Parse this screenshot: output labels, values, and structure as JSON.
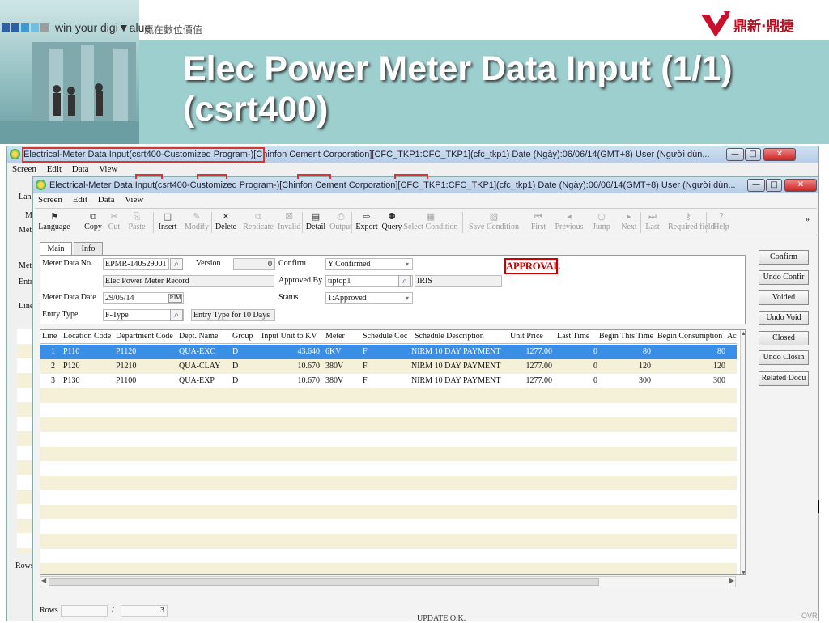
{
  "slide": {
    "brand": "win your digi▼alue",
    "brand_cn": "贏在數位價值",
    "logo_text": "鼎新·鼎捷",
    "title_line1": "Elec Power Meter Data Input (1/1)",
    "title_line2": "(csrt400)",
    "brand_colors": [
      "#2c5fa8",
      "#3a9ad6",
      "#6cc0e6",
      "#9d9d9d"
    ]
  },
  "back_window": {
    "title": "Electrical-Meter Data Input(csrt400-Customized Program-)[Chinfon Cement Corporation][CFC_TKP1:CFC_TKP1](cfc_tkp1)  Date (Ngày):06/06/14(GMT+8)  User (Người dùn...",
    "menu": [
      "Screen",
      "Edit",
      "Data",
      "View"
    ],
    "left_labels": [
      "Lan",
      "M",
      "Met",
      "Met",
      "Entr",
      "Line",
      "Rows"
    ]
  },
  "window": {
    "title": "Electrical-Meter Data Input(csrt400-Customized Program-)[Chinfon Cement Corporation][CFC_TKP1:CFC_TKP1](cfc_tkp1)  Date (Ngày):06/06/14(GMT+8)  User (Người dùn...",
    "menu": [
      "Screen",
      "Edit",
      "Data",
      "View"
    ],
    "controls": {
      "minimize": "—",
      "maximize": "□",
      "close": "✕"
    }
  },
  "toolbar": [
    {
      "label": "Language",
      "icon": "flag-icon",
      "glyph": "⚑",
      "enabled": true
    },
    {
      "label": "Copy",
      "icon": "copy-icon",
      "glyph": "⧉",
      "enabled": true
    },
    {
      "label": "Cut",
      "icon": "scissors-icon",
      "glyph": "✂",
      "enabled": false
    },
    {
      "label": "Paste",
      "icon": "paste-icon",
      "glyph": "⎘",
      "enabled": false
    },
    {
      "label": "Insert",
      "icon": "new-document-icon",
      "glyph": "□",
      "enabled": true
    },
    {
      "label": "Modify",
      "icon": "pencil-icon",
      "glyph": "✎",
      "enabled": false
    },
    {
      "label": "Delete",
      "icon": "delete-x-icon",
      "glyph": "✕",
      "enabled": true
    },
    {
      "label": "Replicate",
      "icon": "replicate-icon",
      "glyph": "⧉",
      "enabled": false
    },
    {
      "label": "Invalid",
      "icon": "trash-icon",
      "glyph": "☒",
      "enabled": false
    },
    {
      "label": "Detail",
      "icon": "detail-icon",
      "glyph": "▤",
      "enabled": true
    },
    {
      "label": "Output",
      "icon": "printer-icon",
      "glyph": "⎙",
      "enabled": false
    },
    {
      "label": "Export",
      "icon": "export-icon",
      "glyph": "⇨",
      "enabled": true
    },
    {
      "label": "Query",
      "icon": "binoculars-icon",
      "glyph": "⚉",
      "enabled": true
    },
    {
      "label": "Select Condition",
      "icon": "select-condition-icon",
      "glyph": "▦",
      "enabled": false
    },
    {
      "label": "Save Condition",
      "icon": "save-condition-icon",
      "glyph": "▧",
      "enabled": false
    },
    {
      "label": "First",
      "icon": "first-record-icon",
      "glyph": "⏮",
      "enabled": false
    },
    {
      "label": "Previous",
      "icon": "previous-record-icon",
      "glyph": "◂",
      "enabled": false
    },
    {
      "label": "Jump",
      "icon": "jump-icon",
      "glyph": "○",
      "enabled": false
    },
    {
      "label": "Next",
      "icon": "next-record-icon",
      "glyph": "▸",
      "enabled": false
    },
    {
      "label": "Last",
      "icon": "last-record-icon",
      "glyph": "⏭",
      "enabled": false
    },
    {
      "label": "Required field",
      "icon": "key-icon",
      "glyph": "⚷",
      "enabled": false
    },
    {
      "label": "Help",
      "icon": "help-icon",
      "glyph": "?",
      "enabled": false
    }
  ],
  "toolbar_more": "»",
  "tabs": [
    "Main",
    "Info"
  ],
  "form": {
    "meter_data_no_label": "Meter Data No.",
    "meter_data_no": "EPMR-140529001",
    "version_label": "Version",
    "version": "0",
    "confirm_label": "Confirm",
    "confirm_value": "Y:Confirmed",
    "description": "Elec Power Meter Record",
    "approved_by_label": "Approved By",
    "approved_by": "tiptop1",
    "approved_by_name": "IRIS",
    "meter_data_date_label": "Meter Data Date",
    "meter_data_date": "29/05/14",
    "calendar_btn": "RJM",
    "status_label": "Status",
    "status_value": "1:Approved",
    "entry_type_label": "Entry Type",
    "entry_type": "F-Type",
    "entry_type_desc": "Entry Type for 10 Days",
    "approval_stamp": "APPROVAL"
  },
  "side_buttons": [
    "Confirm",
    "Undo Confir",
    "Voided",
    "Undo Void",
    "Closed",
    "Undo Closin",
    "Related Docu"
  ],
  "grid": {
    "columns": [
      "Line",
      "Location Code",
      "Department Code",
      "Dept. Name",
      "Group",
      "Input Unit to KV",
      "Meter",
      "Schedule Coc",
      "Schedule Description",
      "Unit Price",
      "Last Time",
      "Begin This Time",
      "Begin Consumption",
      "Ac"
    ],
    "rows": [
      [
        "1",
        "P110",
        "P1120",
        "QUA-EXC",
        "D",
        "43.640",
        "6KV",
        "F",
        "NIRM 10 DAY PAYMENT",
        "1277.00",
        "0",
        "80",
        "80"
      ],
      [
        "2",
        "P120",
        "P1210",
        "QUA-CLAY",
        "D",
        "10.670",
        "380V",
        "F",
        "NIRM 10 DAY PAYMENT",
        "1277.00",
        "0",
        "120",
        "120"
      ],
      [
        "3",
        "P130",
        "P1100",
        "QUA-EXP",
        "D",
        "10.670",
        "380V",
        "F",
        "NIRM 10 DAY PAYMENT",
        "1277.00",
        "0",
        "300",
        "300"
      ]
    ],
    "selected_row": 0,
    "row_colors": {
      "selected": "#3a8ee6",
      "even": "#ffffff",
      "odd": "#f5f0d8"
    }
  },
  "status": {
    "rows_label": "Rows",
    "separator": "/",
    "rows_total": "3",
    "message": "UPDATE O.K.",
    "mode": "OVR"
  }
}
